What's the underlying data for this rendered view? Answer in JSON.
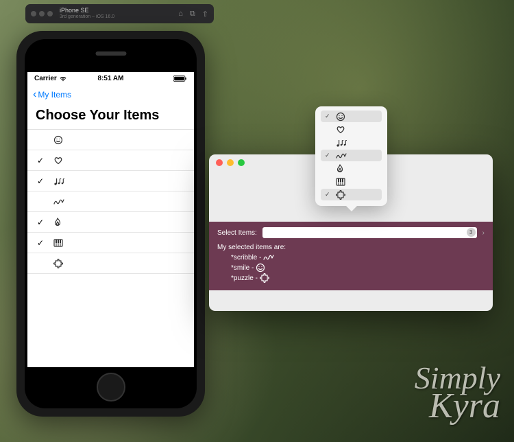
{
  "top_bar": {
    "device_name": "iPhone SE",
    "device_sub": "3rd generation – iOS 16.0"
  },
  "ios": {
    "status": {
      "carrier": "Carrier",
      "time": "8:51 AM"
    },
    "nav": {
      "back_label": "My Items"
    },
    "title": "Choose Your Items",
    "rows": [
      {
        "checked": false,
        "icon": "smile-icon",
        "glyph": "☺"
      },
      {
        "checked": true,
        "icon": "heart-icon",
        "glyph": "♡"
      },
      {
        "checked": true,
        "icon": "music-icon",
        "glyph": "♩♪♪"
      },
      {
        "checked": false,
        "icon": "scribble-icon",
        "glyph": "✎"
      },
      {
        "checked": true,
        "icon": "flame-icon",
        "glyph": "🔥"
      },
      {
        "checked": true,
        "icon": "piano-icon",
        "glyph": "🎹"
      },
      {
        "checked": false,
        "icon": "puzzle-icon",
        "glyph": "✚"
      }
    ]
  },
  "mac": {
    "select_label": "Select Items:",
    "badge_count": "3",
    "selected_heading": "My selected items are:",
    "selected_items": [
      {
        "name": "*scribble",
        "glyph": "✎"
      },
      {
        "name": "*smile",
        "glyph": "☺"
      },
      {
        "name": "*puzzle",
        "glyph": "✚"
      }
    ],
    "popover": [
      {
        "checked": true,
        "icon": "smile-icon",
        "glyph": "☺"
      },
      {
        "checked": false,
        "icon": "heart-icon",
        "glyph": "♡"
      },
      {
        "checked": false,
        "icon": "music-icon",
        "glyph": "♩♪♪"
      },
      {
        "checked": true,
        "icon": "scribble-icon",
        "glyph": "✎"
      },
      {
        "checked": false,
        "icon": "flame-icon",
        "glyph": "🔥"
      },
      {
        "checked": false,
        "icon": "piano-icon",
        "glyph": "🎹"
      },
      {
        "checked": true,
        "icon": "puzzle-icon",
        "glyph": "✚"
      }
    ]
  },
  "watermark": {
    "line1": "Simply",
    "line2": "Kyra"
  }
}
